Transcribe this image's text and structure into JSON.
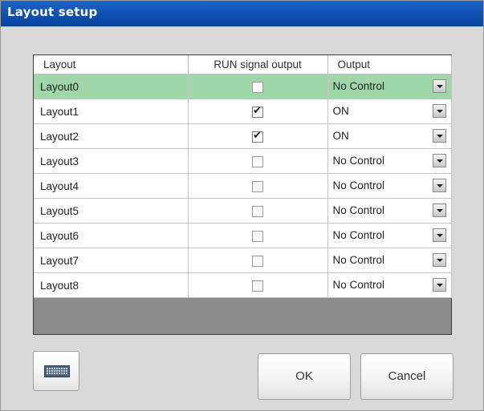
{
  "window": {
    "title": "Layout setup"
  },
  "table": {
    "headers": [
      "Layout",
      "RUN signal output",
      "Output"
    ],
    "rows": [
      {
        "layout": "Layout0",
        "run_signal": false,
        "output": "No Control",
        "selected": true
      },
      {
        "layout": "Layout1",
        "run_signal": true,
        "output": "ON",
        "selected": false
      },
      {
        "layout": "Layout2",
        "run_signal": true,
        "output": "ON",
        "selected": false
      },
      {
        "layout": "Layout3",
        "run_signal": false,
        "output": "No Control",
        "selected": false
      },
      {
        "layout": "Layout4",
        "run_signal": false,
        "output": "No Control",
        "selected": false
      },
      {
        "layout": "Layout5",
        "run_signal": false,
        "output": "No Control",
        "selected": false
      },
      {
        "layout": "Layout6",
        "run_signal": false,
        "output": "No Control",
        "selected": false
      },
      {
        "layout": "Layout7",
        "run_signal": false,
        "output": "No Control",
        "selected": false
      },
      {
        "layout": "Layout8",
        "run_signal": false,
        "output": "No Control",
        "selected": false
      }
    ]
  },
  "buttons": {
    "keyboard_icon": "keyboard-icon",
    "ok_label": "OK",
    "cancel_label": "Cancel"
  },
  "colors": {
    "title_bar": "#0e4fb0",
    "selected_row": "#9ed7a8",
    "dialog_background": "#d9d9d9",
    "grid_empty_area": "#8c8c8c"
  }
}
